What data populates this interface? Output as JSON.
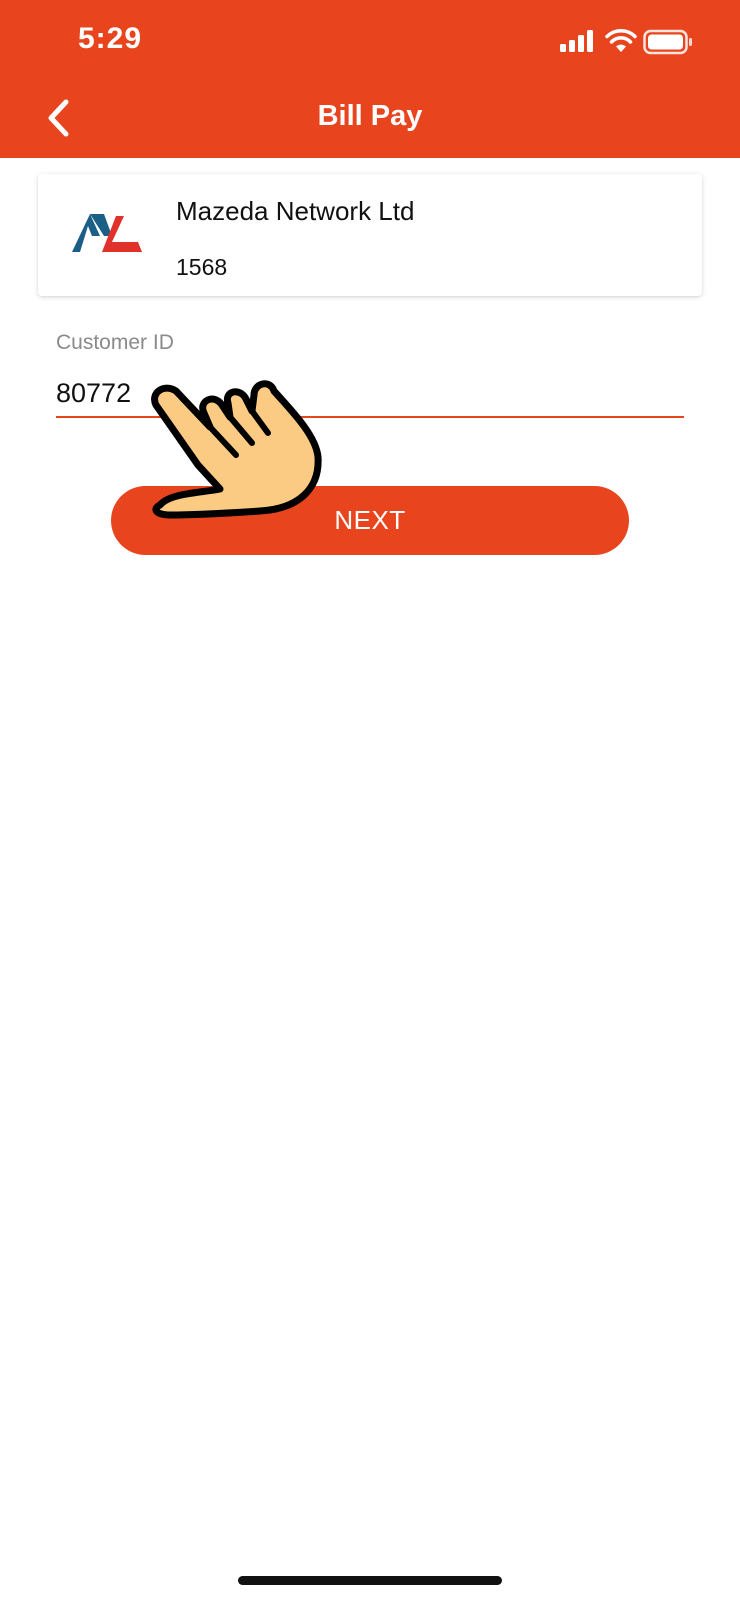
{
  "status_bar": {
    "time": "5:29"
  },
  "header": {
    "title": "Bill Pay",
    "back_icon": "chevron-left-icon"
  },
  "biller": {
    "name": "Mazeda Network Ltd",
    "code": "1568",
    "logo_icon": "mazeda-logo-icon"
  },
  "form": {
    "customer_id_label": "Customer ID",
    "customer_id_value": "80772"
  },
  "actions": {
    "next_label": "NEXT"
  },
  "overlay": {
    "pointer_icon": "tap-hand-icon"
  },
  "colors": {
    "brand": "#E8451F",
    "logo_blue": "#1B5E86",
    "logo_red": "#E0312B"
  }
}
